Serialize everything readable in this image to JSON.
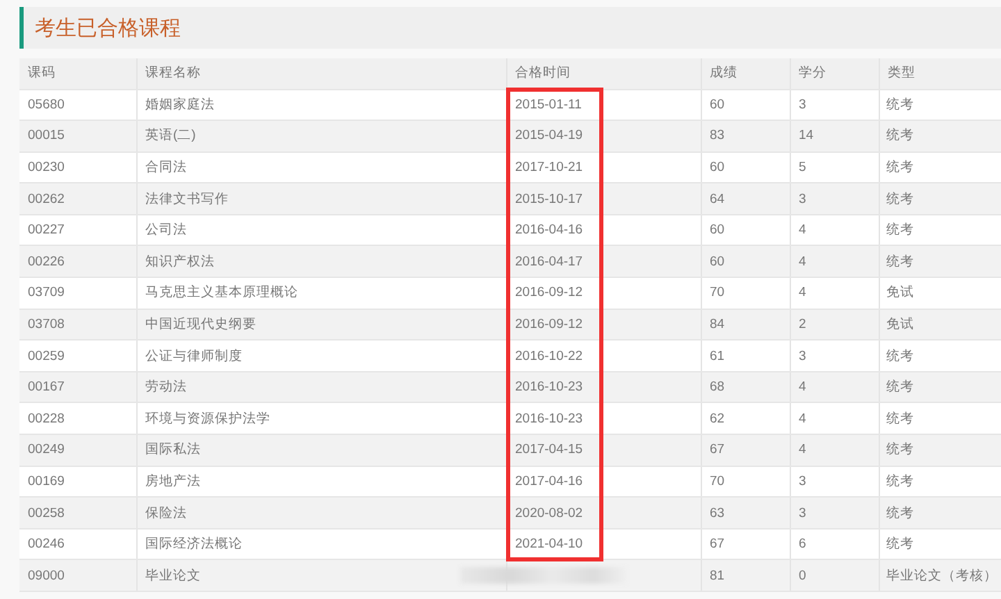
{
  "title": "考生已合格课程",
  "table": {
    "columns": [
      "课码",
      "课程名称",
      "合格时间",
      "成绩",
      "学分",
      "类型"
    ],
    "rows": [
      {
        "code": "05680",
        "name": "婚姻家庭法",
        "date": "2015-01-11",
        "score": "60",
        "credit": "3",
        "type": "统考"
      },
      {
        "code": "00015",
        "name": "英语(二)",
        "date": "2015-04-19",
        "score": "83",
        "credit": "14",
        "type": "统考"
      },
      {
        "code": "00230",
        "name": "合同法",
        "date": "2017-10-21",
        "score": "60",
        "credit": "5",
        "type": "统考"
      },
      {
        "code": "00262",
        "name": "法律文书写作",
        "date": "2015-10-17",
        "score": "64",
        "credit": "3",
        "type": "统考"
      },
      {
        "code": "00227",
        "name": "公司法",
        "date": "2016-04-16",
        "score": "60",
        "credit": "4",
        "type": "统考"
      },
      {
        "code": "00226",
        "name": "知识产权法",
        "date": "2016-04-17",
        "score": "60",
        "credit": "4",
        "type": "统考"
      },
      {
        "code": "03709",
        "name": "马克思主义基本原理概论",
        "date": "2016-09-12",
        "score": "70",
        "credit": "4",
        "type": "免试"
      },
      {
        "code": "03708",
        "name": "中国近现代史纲要",
        "date": "2016-09-12",
        "score": "84",
        "credit": "2",
        "type": "免试"
      },
      {
        "code": "00259",
        "name": "公证与律师制度",
        "date": "2016-10-22",
        "score": "61",
        "credit": "3",
        "type": "统考"
      },
      {
        "code": "00167",
        "name": "劳动法",
        "date": "2016-10-23",
        "score": "68",
        "credit": "4",
        "type": "统考"
      },
      {
        "code": "00228",
        "name": "环境与资源保护法学",
        "date": "2016-10-23",
        "score": "62",
        "credit": "4",
        "type": "统考"
      },
      {
        "code": "00249",
        "name": "国际私法",
        "date": "2017-04-15",
        "score": "67",
        "credit": "4",
        "type": "统考"
      },
      {
        "code": "00169",
        "name": "房地产法",
        "date": "2017-04-16",
        "score": "70",
        "credit": "3",
        "type": "统考"
      },
      {
        "code": "00258",
        "name": "保险法",
        "date": "2020-08-02",
        "score": "63",
        "credit": "3",
        "type": "统考"
      },
      {
        "code": "00246",
        "name": "国际经济法概论",
        "date": "2021-04-10",
        "score": "67",
        "credit": "6",
        "type": "统考"
      },
      {
        "code": "09000",
        "name": "毕业论文",
        "redacted": true,
        "score": "81",
        "credit": "0",
        "type": "毕业论文（考核）"
      }
    ]
  }
}
